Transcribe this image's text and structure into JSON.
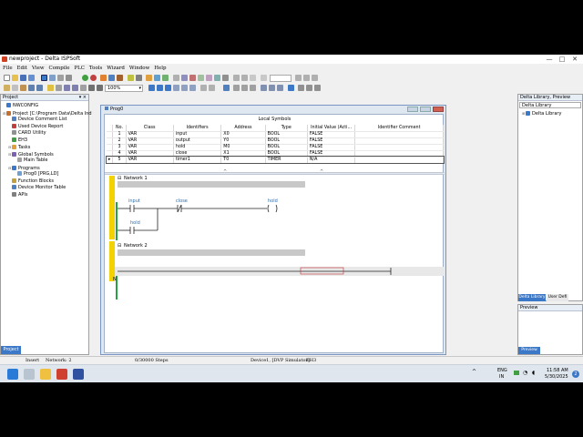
{
  "window": {
    "title": "newproject - Delta ISPSoft",
    "controls": [
      "—",
      "□",
      "✕"
    ]
  },
  "menu": [
    "File",
    "Edit",
    "View",
    "Compile",
    "PLC",
    "Tools",
    "Wizard",
    "Window",
    "Help"
  ],
  "toolbar": {
    "zoom_value": "100%"
  },
  "project_panel": {
    "title": "Project",
    "pin": "▾ ×",
    "tab": "Project",
    "items": [
      {
        "label": "NWCONFIG",
        "indent": 0
      },
      {
        "label": "Project [C:\\Program Data\\Delta Ind",
        "indent": 0
      },
      {
        "label": "Device Comment List",
        "indent": 1
      },
      {
        "label": "Used Device Report",
        "indent": 1
      },
      {
        "label": "CARD Utility",
        "indent": 1
      },
      {
        "label": "EH3",
        "indent": 1
      },
      {
        "label": "Tasks",
        "indent": 1
      },
      {
        "label": "Global Symbols",
        "indent": 1
      },
      {
        "label": "Main Table",
        "indent": 2
      },
      {
        "label": "Programs",
        "indent": 1
      },
      {
        "label": "Prog0 [PRG,LD]",
        "indent": 2
      },
      {
        "label": "Function Blocks",
        "indent": 1
      },
      {
        "label": "Device Monitor Table",
        "indent": 1
      },
      {
        "label": "APIs",
        "indent": 1
      }
    ]
  },
  "program_window": {
    "title": "Prog0",
    "local_symbols_title": "Local Symbols",
    "columns": [
      "No.",
      "Class",
      "Identifiers",
      "Address",
      "Type",
      "Initial Value (Acti...",
      "Identifier Comment"
    ],
    "rows": [
      [
        "1",
        "VAR",
        "input",
        "X0",
        "BOOL",
        "FALSE",
        ""
      ],
      [
        "2",
        "VAR",
        "output",
        "Y0",
        "BOOL",
        "FALSE",
        ""
      ],
      [
        "3",
        "VAR",
        "hold",
        "M0",
        "BOOL",
        "FALSE",
        ""
      ],
      [
        "4",
        "VAR",
        "close",
        "X1",
        "BOOL",
        "FALSE",
        ""
      ],
      [
        "5",
        "VAR",
        "timer1",
        "T0",
        "TIMER",
        "N/A",
        ""
      ]
    ],
    "selected_row_marker": "▸",
    "networks": [
      {
        "label": "Network 1"
      },
      {
        "label": "Network 2"
      }
    ],
    "ladder_labels": {
      "input": "input",
      "close": "close",
      "hold_coil": "hold",
      "hold_contact": "hold"
    },
    "cursor_mark": "N"
  },
  "library_panel": {
    "title": "Delta Library, Preview",
    "dropdown": "Delta Library",
    "root_item": "Delta Library",
    "tabs": [
      "Delta Library",
      "User Defi"
    ],
    "preview_title": "Preview",
    "preview_tab": "Preview"
  },
  "status": {
    "insert": "Insert",
    "network": "Network: 2",
    "steps": "0/30000 Steps",
    "device": "Device1, [DVP Simulator]",
    "model": "EH3"
  },
  "taskbar": {
    "lang": "ENG",
    "region": "IN",
    "time": "11:58 AM",
    "date": "5/30/2025",
    "notif": "2"
  },
  "colors": {
    "accent": "#3c78c8",
    "network_bar": "#f2d200",
    "gray_band": "#c8c8c8"
  }
}
